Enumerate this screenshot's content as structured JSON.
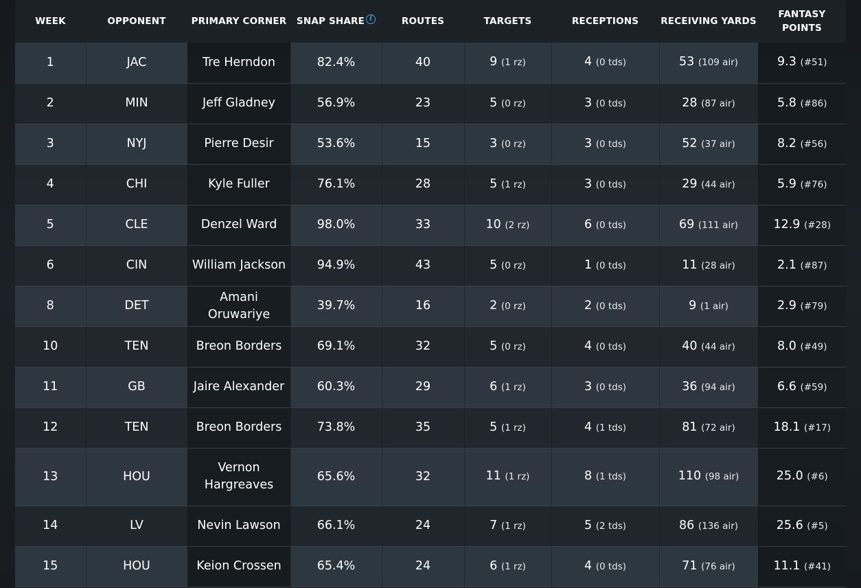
{
  "headers": {
    "week": "WEEK",
    "opponent": "OPPONENT",
    "primary_corner": "PRIMARY CORNER",
    "snap_share": "SNAP SHARE",
    "routes": "ROUTES",
    "targets": "TARGETS",
    "receptions": "RECEPTIONS",
    "receiving_yards": "RECEIVING YARDS",
    "fantasy_points": "FANTASY POINTS",
    "info_icon_glyph": "i"
  },
  "colors": {
    "accent": "#3da5e6",
    "row_light": "#303a42",
    "row_dark": "#22282e",
    "header_bg": "#1c2125"
  },
  "rows": [
    {
      "week": "1",
      "opponent": "JAC",
      "corner": "Tre Herndon",
      "snap": "82.4%",
      "routes": "40",
      "targets": "9",
      "targets_sub": "(1 rz)",
      "receptions": "4",
      "receptions_sub": "(0 tds)",
      "yards": "53",
      "yards_sub": "(109 air)",
      "fp": "9.3",
      "fp_sub": "(#51)"
    },
    {
      "week": "2",
      "opponent": "MIN",
      "corner": "Jeff Gladney",
      "snap": "56.9%",
      "routes": "23",
      "targets": "5",
      "targets_sub": "(0 rz)",
      "receptions": "3",
      "receptions_sub": "(0 tds)",
      "yards": "28",
      "yards_sub": "(87 air)",
      "fp": "5.8",
      "fp_sub": "(#86)"
    },
    {
      "week": "3",
      "opponent": "NYJ",
      "corner": "Pierre Desir",
      "snap": "53.6%",
      "routes": "15",
      "targets": "3",
      "targets_sub": "(0 rz)",
      "receptions": "3",
      "receptions_sub": "(0 tds)",
      "yards": "52",
      "yards_sub": "(37 air)",
      "fp": "8.2",
      "fp_sub": "(#56)"
    },
    {
      "week": "4",
      "opponent": "CHI",
      "corner": "Kyle Fuller",
      "snap": "76.1%",
      "routes": "28",
      "targets": "5",
      "targets_sub": "(1 rz)",
      "receptions": "3",
      "receptions_sub": "(0 tds)",
      "yards": "29",
      "yards_sub": "(44 air)",
      "fp": "5.9",
      "fp_sub": "(#76)"
    },
    {
      "week": "5",
      "opponent": "CLE",
      "corner": "Denzel Ward",
      "snap": "98.0%",
      "routes": "33",
      "targets": "10",
      "targets_sub": "(2 rz)",
      "receptions": "6",
      "receptions_sub": "(0 tds)",
      "yards": "69",
      "yards_sub": "(111 air)",
      "fp": "12.9",
      "fp_sub": "(#28)"
    },
    {
      "week": "6",
      "opponent": "CIN",
      "corner": "William Jackson",
      "snap": "94.9%",
      "routes": "43",
      "targets": "5",
      "targets_sub": "(0 rz)",
      "receptions": "1",
      "receptions_sub": "(0 tds)",
      "yards": "11",
      "yards_sub": "(28 air)",
      "fp": "2.1",
      "fp_sub": "(#87)"
    },
    {
      "week": "8",
      "opponent": "DET",
      "corner": "Amani Oruwariye",
      "snap": "39.7%",
      "routes": "16",
      "targets": "2",
      "targets_sub": "(0 rz)",
      "receptions": "2",
      "receptions_sub": "(0 tds)",
      "yards": "9",
      "yards_sub": "(1 air)",
      "fp": "2.9",
      "fp_sub": "(#79)"
    },
    {
      "week": "10",
      "opponent": "TEN",
      "corner": "Breon Borders",
      "snap": "69.1%",
      "routes": "32",
      "targets": "5",
      "targets_sub": "(0 rz)",
      "receptions": "4",
      "receptions_sub": "(0 tds)",
      "yards": "40",
      "yards_sub": "(44 air)",
      "fp": "8.0",
      "fp_sub": "(#49)"
    },
    {
      "week": "11",
      "opponent": "GB",
      "corner": "Jaire Alexander",
      "snap": "60.3%",
      "routes": "29",
      "targets": "6",
      "targets_sub": "(1 rz)",
      "receptions": "3",
      "receptions_sub": "(0 tds)",
      "yards": "36",
      "yards_sub": "(94 air)",
      "fp": "6.6",
      "fp_sub": "(#59)"
    },
    {
      "week": "12",
      "opponent": "TEN",
      "corner": "Breon Borders",
      "snap": "73.8%",
      "routes": "35",
      "targets": "5",
      "targets_sub": "(1 rz)",
      "receptions": "4",
      "receptions_sub": "(1 tds)",
      "yards": "81",
      "yards_sub": "(72 air)",
      "fp": "18.1",
      "fp_sub": "(#17)"
    },
    {
      "week": "13",
      "opponent": "HOU",
      "corner": "Vernon Hargreaves",
      "snap": "65.6%",
      "routes": "32",
      "targets": "11",
      "targets_sub": "(1 rz)",
      "receptions": "8",
      "receptions_sub": "(1 tds)",
      "yards": "110",
      "yards_sub": "(98 air)",
      "fp": "25.0",
      "fp_sub": "(#6)"
    },
    {
      "week": "14",
      "opponent": "LV",
      "corner": "Nevin Lawson",
      "snap": "66.1%",
      "routes": "24",
      "targets": "7",
      "targets_sub": "(1 rz)",
      "receptions": "5",
      "receptions_sub": "(2 tds)",
      "yards": "86",
      "yards_sub": "(136 air)",
      "fp": "25.6",
      "fp_sub": "(#5)"
    },
    {
      "week": "15",
      "opponent": "HOU",
      "corner": "Keion Crossen",
      "snap": "65.4%",
      "routes": "24",
      "targets": "6",
      "targets_sub": "(1 rz)",
      "receptions": "4",
      "receptions_sub": "(0 tds)",
      "yards": "71",
      "yards_sub": "(76 air)",
      "fp": "11.1",
      "fp_sub": "(#41)"
    }
  ]
}
